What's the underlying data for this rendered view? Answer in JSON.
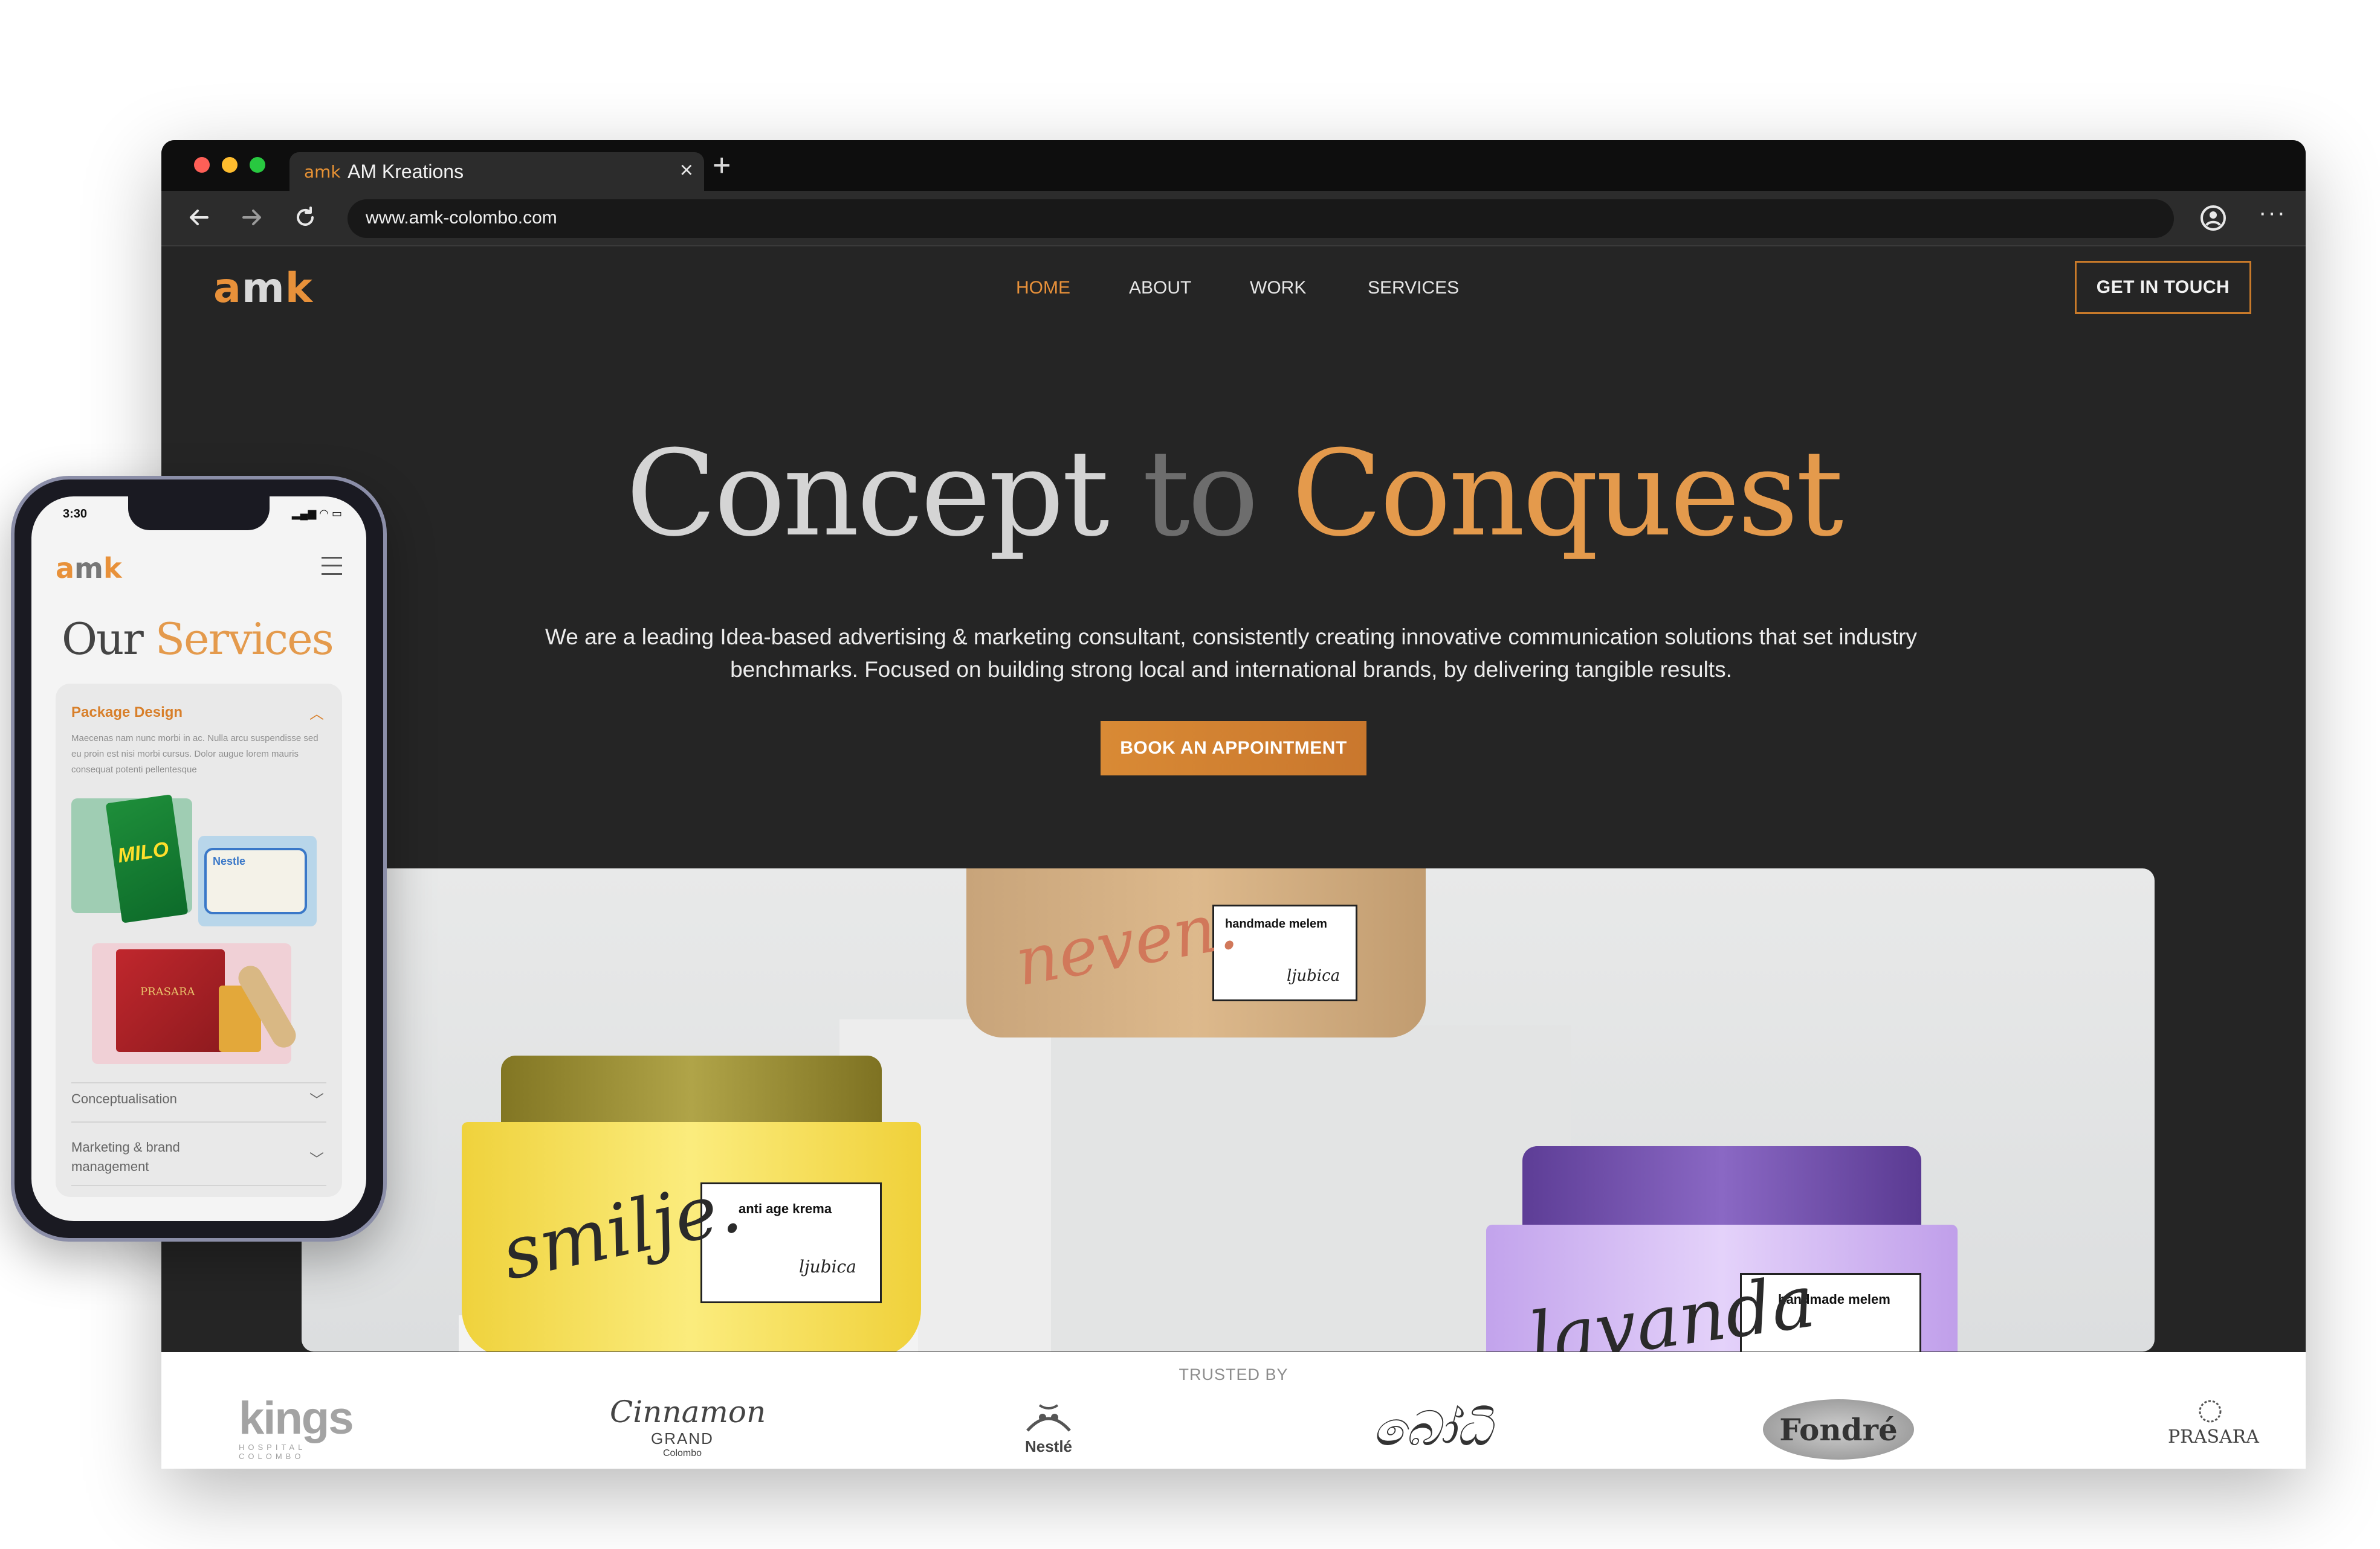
{
  "browser": {
    "tab": {
      "favicon": "amk",
      "title": "AM Kreations",
      "close": "×"
    },
    "new_tab": "+",
    "url": "www.amk-colombo.com",
    "icons": [
      "back-arrow-icon",
      "forward-arrow-icon",
      "reload-icon",
      "account-icon",
      "more-icon"
    ],
    "more": "···"
  },
  "site": {
    "logo": {
      "a": "a",
      "m": "m",
      "k": "k"
    },
    "nav": {
      "home": "HOME",
      "about": "ABOUT",
      "work": "WORK",
      "services": "SERVICES"
    },
    "get_in_touch": "GET IN TOUCH",
    "hero": {
      "word1": "Concept",
      "word2": "to",
      "word3": "Conquest",
      "subtitle": "We are a leading Idea-based advertising & marketing consultant, consistently creating innovative communication solutions that set industry benchmarks. Focused on building strong local and international brands, by delivering tangible results.",
      "cta": "BOOK AN APPOINTMENT"
    },
    "products": {
      "top_script": "neven.",
      "top_label": "handmade melem",
      "top_brand": "ljubica",
      "left_script": "smilje.",
      "left_label": "anti age krema",
      "left_brand": "ljubica",
      "right_script": "lavanda",
      "right_label": "handmade melem"
    },
    "trusted": {
      "label": "TRUSTED BY",
      "brands": {
        "kings": "kings",
        "kings_sub": "HOSPITAL\nCOLOMBO",
        "cinnamon": "Cinnamon",
        "cinnamon_sub1": "GRAND",
        "cinnamon_sub2": "Colombo",
        "nestle": "Nestlé",
        "bodhi": "බෝධි",
        "fondre": "Fondré",
        "prasara": "PRASARA"
      }
    }
  },
  "phone": {
    "time": "3:30",
    "status": "▂▄▆ ◠ ▭",
    "logo": {
      "a": "a",
      "m": "m",
      "k": "k"
    },
    "title_a": "Our",
    "title_b": "Services",
    "services": {
      "open_title": "Package Design",
      "open_desc": "Maecenas nam nunc morbi in ac. Nulla arcu suspendisse sed eu proin est nisi morbi cursus. Dolor augue lorem mauris consequat potenti pellentesque",
      "item2": "Conceptualisation",
      "item3": "Marketing & brand management"
    },
    "product_labels": {
      "milo": "MILO",
      "nestle": "Nestle",
      "prasara": "PRASARA"
    }
  },
  "colors": {
    "accent": "#e8913a",
    "background": "#252525",
    "tab_bar": "#0e0e0e"
  }
}
